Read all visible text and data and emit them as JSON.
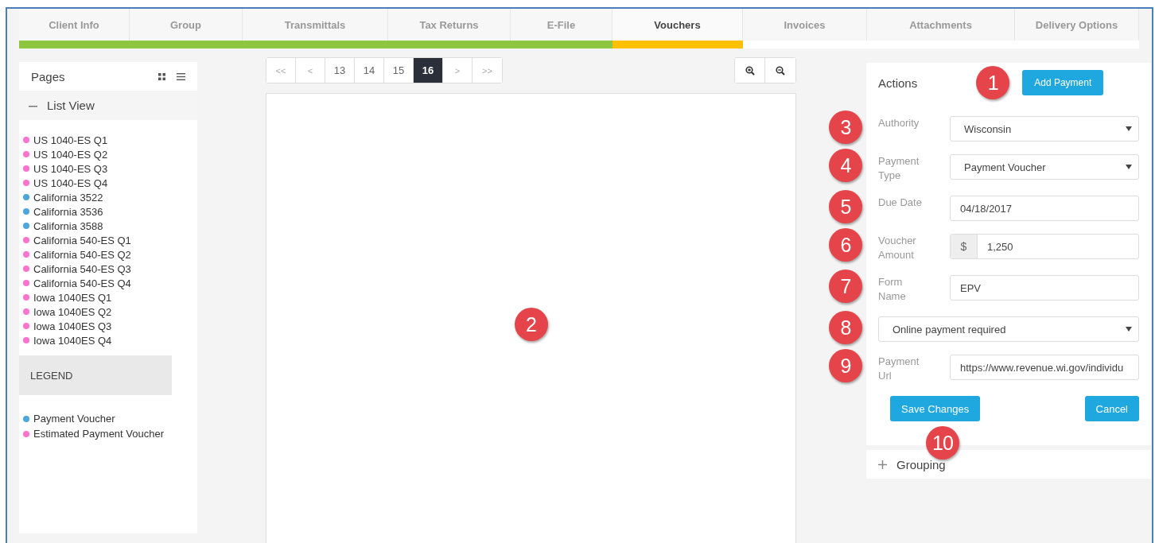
{
  "tabs": [
    {
      "label": "Client Info",
      "selected": false,
      "color": "#8dc63f"
    },
    {
      "label": "Group",
      "selected": false,
      "color": "#8dc63f"
    },
    {
      "label": "Transmittals",
      "selected": false,
      "color": "#8dc63f"
    },
    {
      "label": "Tax Returns",
      "selected": false,
      "color": "#8dc63f"
    },
    {
      "label": "E-File",
      "selected": false,
      "color": "#8dc63f"
    },
    {
      "label": "Vouchers",
      "selected": true,
      "color": "#ffc000"
    },
    {
      "label": "Invoices",
      "selected": false
    },
    {
      "label": "Attachments",
      "selected": false
    },
    {
      "label": "Delivery Options",
      "selected": false
    }
  ],
  "pages_panel": {
    "title": "Pages",
    "list_view": {
      "label": "List View",
      "expanded": true
    },
    "items": [
      {
        "label": "US 1040-ES Q1",
        "color": "#ff73d0"
      },
      {
        "label": "US 1040-ES Q2",
        "color": "#ff73d0"
      },
      {
        "label": "US 1040-ES Q3",
        "color": "#ff73d0"
      },
      {
        "label": "US 1040-ES Q4",
        "color": "#ff73d0"
      },
      {
        "label": "California 3522",
        "color": "#4ea6df"
      },
      {
        "label": "California 3536",
        "color": "#4ea6df"
      },
      {
        "label": "California 3588",
        "color": "#4ea6df"
      },
      {
        "label": "California 540-ES Q1",
        "color": "#ff73d0"
      },
      {
        "label": "California 540-ES Q2",
        "color": "#ff73d0"
      },
      {
        "label": "California 540-ES Q3",
        "color": "#ff73d0"
      },
      {
        "label": "California 540-ES Q4",
        "color": "#ff73d0"
      },
      {
        "label": "Iowa 1040ES Q1",
        "color": "#ff73d0"
      },
      {
        "label": "Iowa 1040ES Q2",
        "color": "#ff73d0"
      },
      {
        "label": "Iowa 1040ES Q3",
        "color": "#ff73d0"
      },
      {
        "label": "Iowa 1040ES Q4",
        "color": "#ff73d0"
      }
    ],
    "legend": {
      "title": "LEGEND",
      "items": [
        {
          "label": "Payment Voucher",
          "color": "#4ea6df"
        },
        {
          "label": "Estimated Payment Voucher",
          "color": "#ff73d0"
        }
      ]
    }
  },
  "pager": [
    {
      "label": "<<",
      "selected": false
    },
    {
      "label": "<",
      "selected": false
    },
    {
      "label": "13",
      "selected": false
    },
    {
      "label": "14",
      "selected": false
    },
    {
      "label": "15",
      "selected": false
    },
    {
      "label": "16",
      "selected": true
    },
    {
      "label": ">",
      "selected": false
    },
    {
      "label": ">>",
      "selected": false
    }
  ],
  "actions": {
    "title": "Actions",
    "add_button": "Add Payment",
    "fields": [
      {
        "kind": "select",
        "label": "Authority",
        "value": "Wisconsin"
      },
      {
        "kind": "select",
        "label": "Payment Type",
        "value": "Payment Voucher"
      },
      {
        "kind": "input",
        "label": "Due Date",
        "value": "04/18/2017"
      },
      {
        "kind": "currency",
        "label": "Voucher Amount",
        "prefix": "$",
        "value": "1,250"
      },
      {
        "kind": "input",
        "label": "Form Name",
        "value": "EPV"
      },
      {
        "kind": "select",
        "value": "Online payment required"
      },
      {
        "kind": "input",
        "label": "Payment Url",
        "value": "https://www.revenue.wi.gov/individu"
      }
    ],
    "buttons": [
      "Save Changes",
      "Cancel"
    ]
  },
  "grouping": {
    "label": "Grouping",
    "expanded": false
  },
  "callouts": [
    "1",
    "2",
    "3",
    "4",
    "5",
    "6",
    "7",
    "8",
    "9",
    "10"
  ]
}
